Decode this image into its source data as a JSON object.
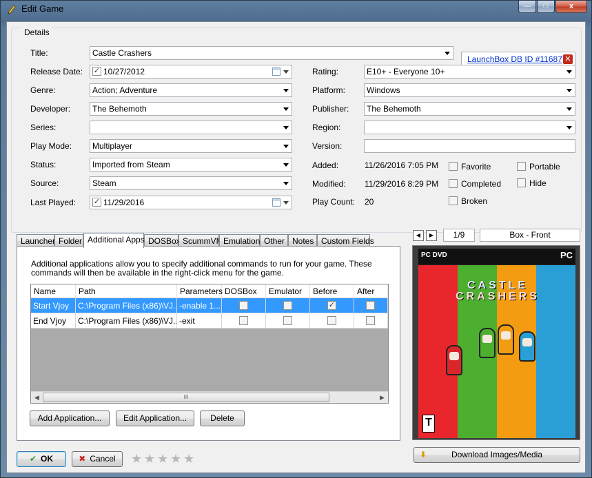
{
  "window": {
    "title": "Edit Game",
    "controls": {
      "minimize": "—",
      "maximize": "□",
      "close": "x"
    }
  },
  "details": {
    "legend": "Details",
    "title_label": "Title:",
    "title_value": "Castle Crashers",
    "db_link": "LaunchBox DB ID #11687",
    "release_label": "Release Date:",
    "release_value": "10/27/2012",
    "rating_label": "Rating:",
    "rating_value": "E10+ - Everyone 10+",
    "genre_label": "Genre:",
    "genre_value": "Action; Adventure",
    "platform_label": "Platform:",
    "platform_value": "Windows",
    "developer_label": "Developer:",
    "developer_value": "The Behemoth",
    "publisher_label": "Publisher:",
    "publisher_value": "The Behemoth",
    "series_label": "Series:",
    "series_value": "",
    "region_label": "Region:",
    "region_value": "",
    "playmode_label": "Play Mode:",
    "playmode_value": "Multiplayer",
    "version_label": "Version:",
    "version_value": "",
    "status_label": "Status:",
    "status_value": "Imported from Steam",
    "added_label": "Added:",
    "added_value": "11/26/2016 7:05 PM",
    "source_label": "Source:",
    "source_value": "Steam",
    "modified_label": "Modified:",
    "modified_value": "11/29/2016 8:29 PM",
    "lastplayed_label": "Last Played:",
    "lastplayed_value": "11/29/2016",
    "playcount_label": "Play Count:",
    "playcount_value": "20",
    "checkboxes": {
      "favorite": "Favorite",
      "portable": "Portable",
      "completed": "Completed",
      "hide": "Hide",
      "broken": "Broken"
    }
  },
  "tabs": [
    "Launcher",
    "Folder",
    "Additional Apps",
    "DOSBox",
    "ScummVM",
    "Emulation",
    "Other",
    "Notes",
    "Custom Fields"
  ],
  "additional_apps": {
    "description": "Additional applications allow you to specify additional commands to run for your game.  These commands will then be available in the right-click menu for the game.",
    "columns": [
      "Name",
      "Path",
      "Parameters",
      "DOSBox",
      "Emulator",
      "Before",
      "After"
    ],
    "rows": [
      {
        "name": "Start Vjoy",
        "path": "C:\\Program Files (x86)\\VJ...",
        "params": "-enable 1...",
        "dosbox": false,
        "emulator": false,
        "before": true,
        "after": false
      },
      {
        "name": "End Vjoy",
        "path": "C:\\Program Files (x86)\\VJ...",
        "params": "-exit",
        "dosbox": false,
        "emulator": false,
        "before": false,
        "after": false
      }
    ],
    "scroll_grip": "III",
    "add_button": "Add Application...",
    "edit_button": "Edit Application...",
    "delete_button": "Delete"
  },
  "image_panel": {
    "page": "1/9",
    "image_type": "Box - Front",
    "cover": {
      "platform_top": "PC DVD",
      "platform_corner": "PC",
      "title_line1": "CASTLE",
      "title_line2": "CRASHERS",
      "rating": "T"
    },
    "download_button": "Download Images/Media"
  },
  "footer": {
    "ok": "OK",
    "cancel": "Cancel",
    "rating_stars": 0
  },
  "colors": {
    "link": "#0033cc",
    "selection": "#3399ff",
    "stripe_red": "#e8262b",
    "stripe_green": "#4caf2f",
    "stripe_orange": "#f39c12",
    "stripe_blue": "#2a9fd6"
  }
}
